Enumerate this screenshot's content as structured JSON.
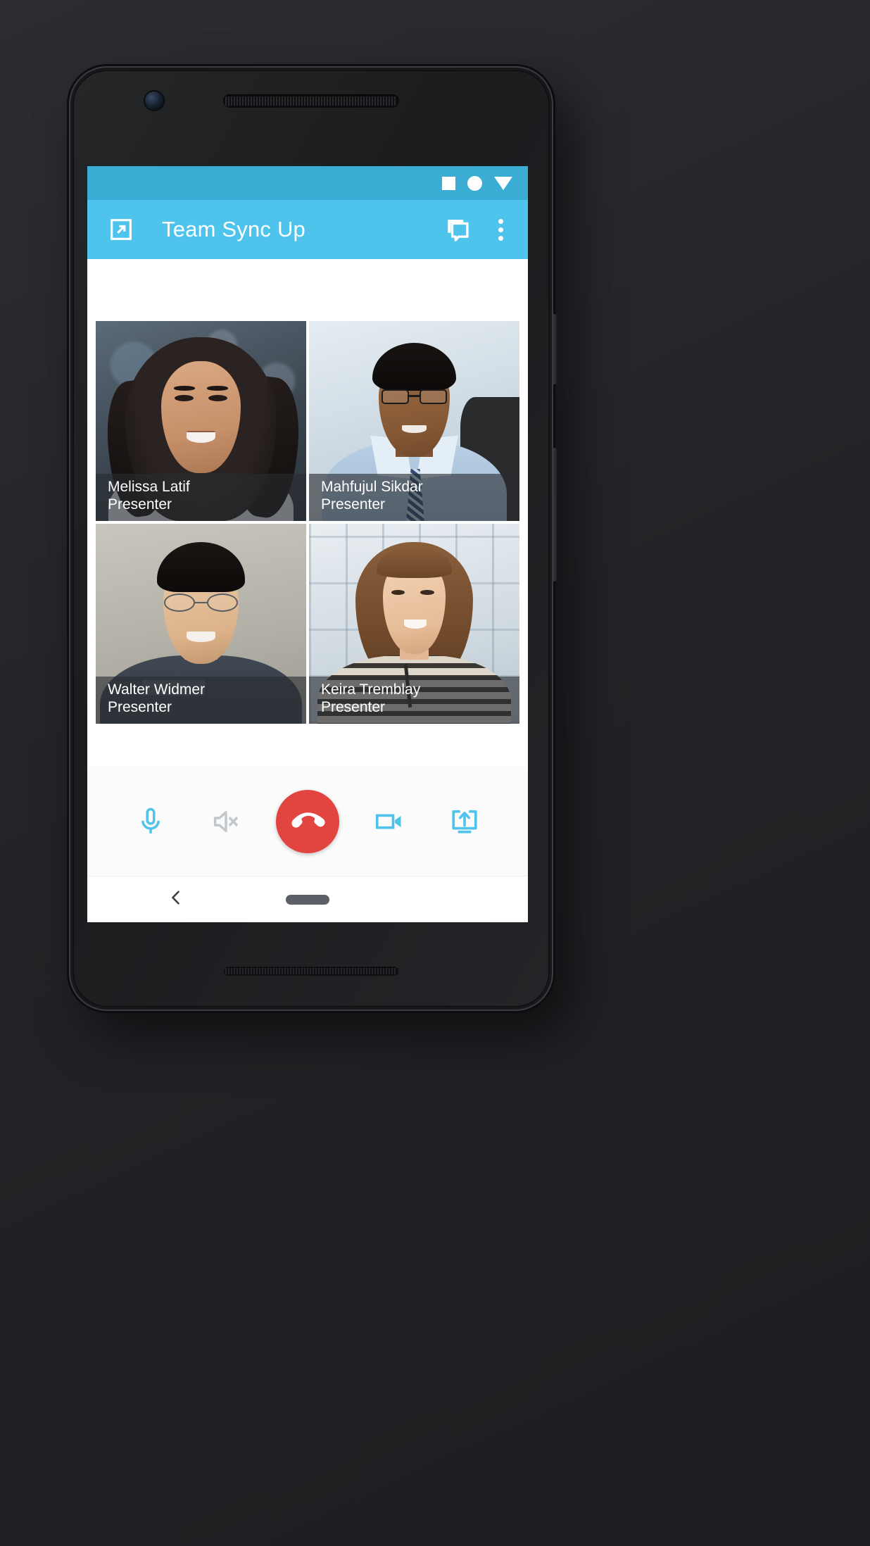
{
  "app": {
    "title": "Team Sync Up",
    "accent_color": "#4ec3ec",
    "status_bar_color": "#3bacd4",
    "hangup_color": "#e2443f",
    "icon_blue": "#4ec3ec",
    "icon_gray": "#c2c7cb"
  },
  "status_bar": {
    "icons": [
      "square-icon",
      "circle-icon",
      "triangle-down-icon"
    ]
  },
  "app_bar": {
    "nav_icon": "open-in-new-icon",
    "title": "Team Sync Up",
    "actions": [
      {
        "name": "chat-bubbles-icon",
        "label": "Chat"
      },
      {
        "name": "overflow-menu-icon",
        "label": "More options"
      }
    ]
  },
  "participants": [
    {
      "name": "Melissa Latif",
      "role": "Presenter"
    },
    {
      "name": "Mahfujul Sikdar",
      "role": "Presenter"
    },
    {
      "name": "Walter Widmer",
      "role": "Presenter"
    },
    {
      "name": "Keira Tremblay",
      "role": "Presenter"
    }
  ],
  "controls": [
    {
      "name": "microphone-icon",
      "label": "Microphone",
      "state": "on",
      "color": "#4ec3ec"
    },
    {
      "name": "speaker-mute-icon",
      "label": "Speaker muted",
      "state": "muted",
      "color": "#c2c7cb"
    },
    {
      "name": "hangup-icon",
      "label": "End call",
      "state": "active",
      "color": "#e2443f"
    },
    {
      "name": "video-camera-icon",
      "label": "Camera",
      "state": "on",
      "color": "#4ec3ec"
    },
    {
      "name": "screen-share-icon",
      "label": "Share screen",
      "state": "on",
      "color": "#4ec3ec"
    }
  ],
  "nav_bar": {
    "back": "back-chevron-icon",
    "home": "home-pill-icon"
  }
}
